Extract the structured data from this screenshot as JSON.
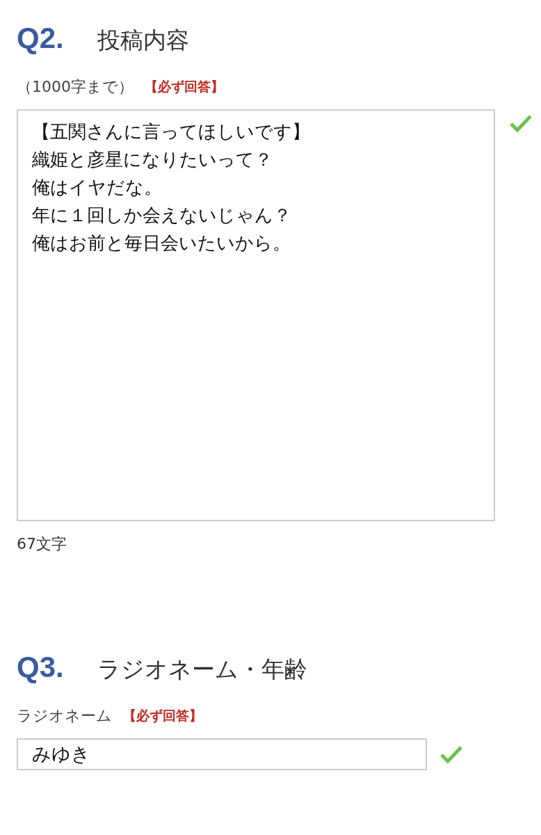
{
  "questions": [
    {
      "kind": "textarea",
      "number": "Q2.",
      "title": "投稿内容",
      "hint": "（1000字まで）",
      "required": "【必ず回答】",
      "lines": [
        "【五関さんに言ってほしいです】",
        "織姫と彦星になりたいって？",
        "俺はイヤだな。",
        "年に１回しか会えないじゃん？",
        "俺はお前と毎日会いたいから。"
      ],
      "valid": true,
      "counter": "67文字"
    },
    {
      "kind": "input",
      "number": "Q3.",
      "title": "ラジオネーム・年齢",
      "hint": "ラジオネーム",
      "required": "【必ず回答】",
      "value": "みゆき",
      "valid": true
    }
  ]
}
